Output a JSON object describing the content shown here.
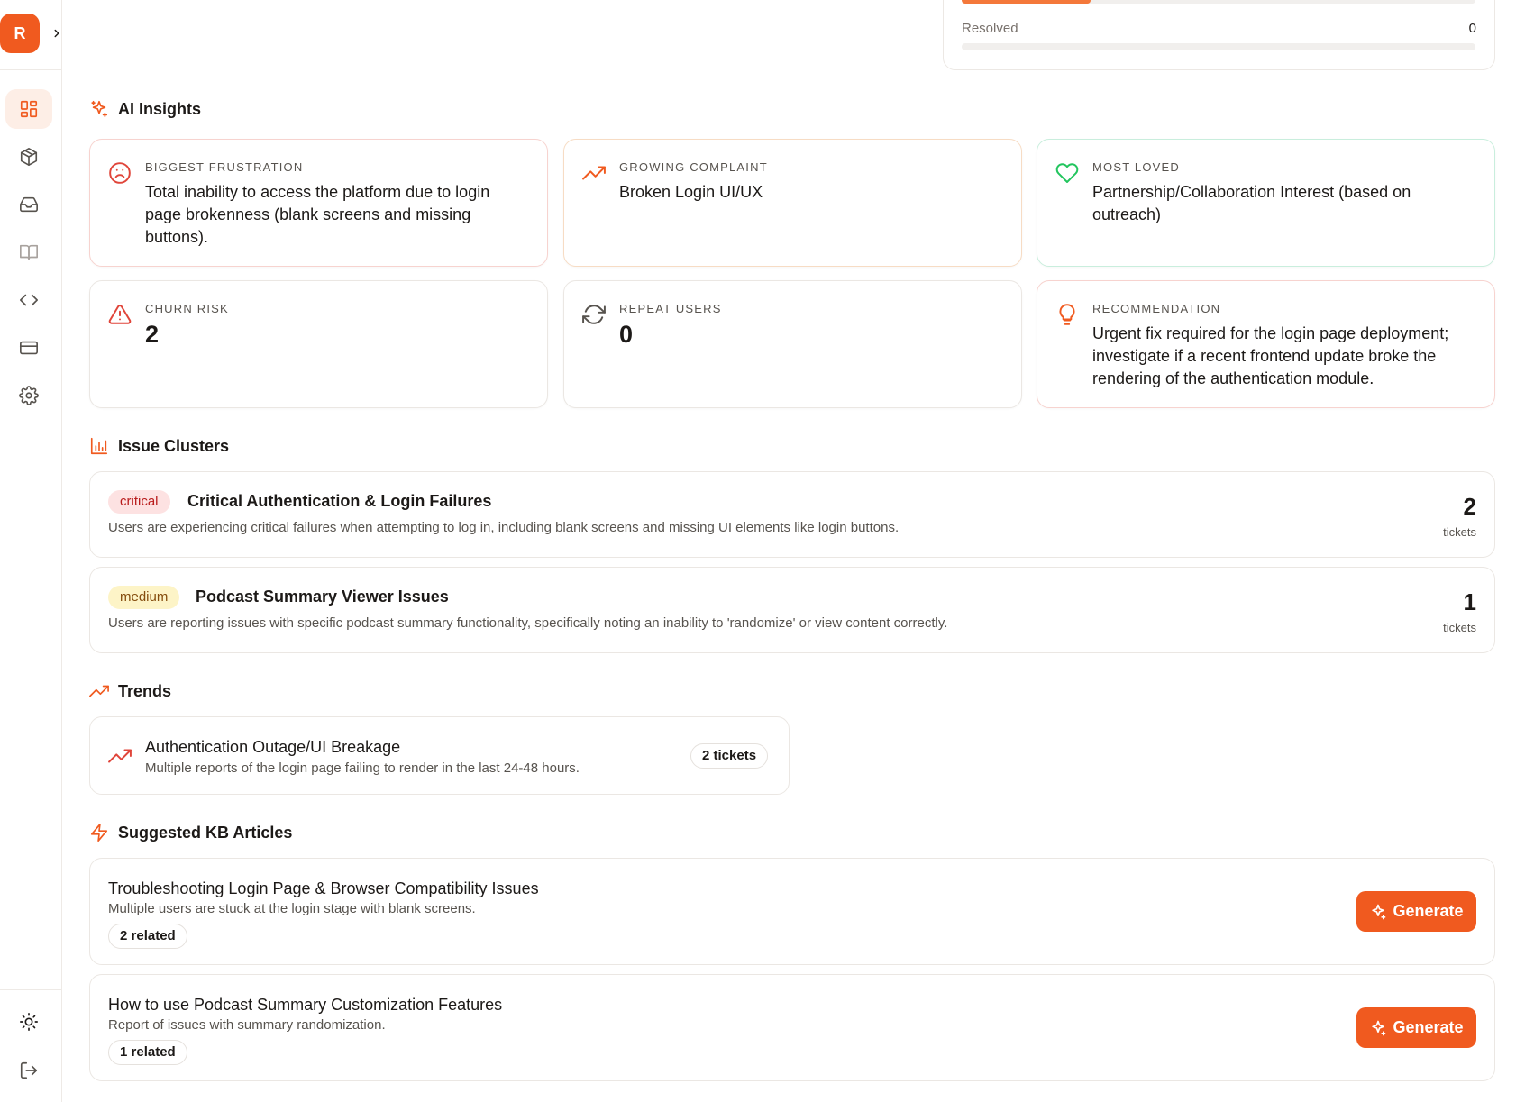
{
  "sidebar": {
    "logo_letter": "R",
    "nav": [
      {
        "icon": "dashboard-icon",
        "active": true
      },
      {
        "icon": "package-icon"
      },
      {
        "icon": "inbox-icon"
      },
      {
        "icon": "book-icon"
      },
      {
        "icon": "code-icon"
      },
      {
        "icon": "credit-card-icon"
      },
      {
        "icon": "settings-icon"
      }
    ],
    "bottom": [
      {
        "icon": "sun-icon"
      },
      {
        "icon": "logout-icon"
      }
    ]
  },
  "status": {
    "label": "Resolved",
    "value": "0",
    "resolved_fraction": 0
  },
  "ai_insights": {
    "title": "AI Insights",
    "cards": [
      {
        "label": "Biggest Frustration",
        "text": "Total inability to access the platform due to login page brokenness (blank screens and missing buttons).",
        "icon": "frown-icon"
      },
      {
        "label": "Growing Complaint",
        "text": "Broken Login UI/UX",
        "icon": "trending-up-icon"
      },
      {
        "label": "Most Loved",
        "text": "Partnership/Collaboration Interest (based on outreach)",
        "icon": "heart-icon"
      },
      {
        "label": "Churn Risk",
        "value": "2",
        "icon": "warning-icon"
      },
      {
        "label": "Repeat Users",
        "value": "0",
        "icon": "refresh-icon"
      },
      {
        "label": "Recommendation",
        "text": "Urgent fix required for the login page deployment; investigate if a recent frontend update broke the rendering of the authentication module.",
        "icon": "lightbulb-icon"
      }
    ]
  },
  "issue_clusters": {
    "title": "Issue Clusters",
    "items": [
      {
        "severity": "critical",
        "title": "Critical Authentication & Login Failures",
        "description": "Users are experiencing critical failures when attempting to log in, including blank screens and missing UI elements like login buttons.",
        "count": "2",
        "unit": "tickets"
      },
      {
        "severity": "medium",
        "title": "Podcast Summary Viewer Issues",
        "description": "Users are reporting issues with specific podcast summary functionality, specifically noting an inability to 'randomize' or view content correctly.",
        "count": "1",
        "unit": "tickets"
      }
    ]
  },
  "trends": {
    "title": "Trends",
    "items": [
      {
        "title": "Authentication Outage/UI Breakage",
        "description": "Multiple reports of the login page failing to render in the last 24-48 hours.",
        "count_label": "2 tickets"
      }
    ]
  },
  "kb": {
    "title": "Suggested KB Articles",
    "button_label": "Generate",
    "items": [
      {
        "title": "Troubleshooting Login Page & Browser Compatibility Issues",
        "description": "Multiple users are stuck at the login stage with blank screens.",
        "related": "2 related"
      },
      {
        "title": "How to use Podcast Summary Customization Features",
        "description": "Report of issues with summary randomization.",
        "related": "1 related"
      }
    ]
  },
  "colors": {
    "accent": "#f05a1f",
    "critical_bg": "#fde2e2",
    "medium_bg": "#fdf4c7"
  }
}
